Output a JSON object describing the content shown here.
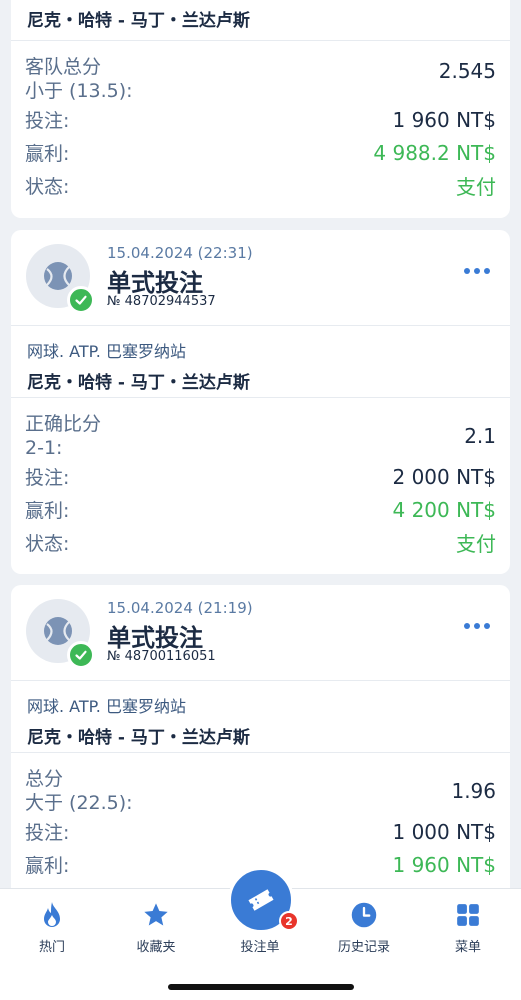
{
  "colors": {
    "accent": "#3a7bd5",
    "success": "#3db856",
    "badge": "#e8352b",
    "text_dark": "#1c2b43",
    "text_muted": "#5a6f8c",
    "background": "#eef1f5"
  },
  "cards": [
    {
      "event": "尼克・哈特 - 马丁・兰达卢斯",
      "market_title": "客队总分",
      "market_pick": "小于 (13.5):",
      "odds": "2.545",
      "stake_label": "投注:",
      "stake": "1 960 NT$",
      "win_label": "赢利:",
      "win": "4 988.2 NT$",
      "status_label": "状态:",
      "status": "支付"
    },
    {
      "date": "15.04.2024 (22:31)",
      "bet_type": "单式投注",
      "bet_number": "№ 48702944537",
      "league": "网球. ATP. 巴塞罗纳站",
      "event": "尼克・哈特 - 马丁・兰达卢斯",
      "market_title": "正确比分",
      "market_pick": "2-1:",
      "odds": "2.1",
      "stake_label": "投注:",
      "stake": "2 000 NT$",
      "win_label": "赢利:",
      "win": "4 200 NT$",
      "status_label": "状态:",
      "status": "支付",
      "sport_icon": "tennis-ball-icon",
      "status_icon": "check-icon"
    },
    {
      "date": "15.04.2024 (21:19)",
      "bet_type": "单式投注",
      "bet_number": "№ 48700116051",
      "league": "网球. ATP. 巴塞罗纳站",
      "event": "尼克・哈特 - 马丁・兰达卢斯",
      "market_title": "总分",
      "market_pick": "大于 (22.5):",
      "odds": "1.96",
      "stake_label": "投注:",
      "stake": "1 000 NT$",
      "win_label": "赢利:",
      "win": "1 960 NT$",
      "sport_icon": "tennis-ball-icon",
      "status_icon": "check-icon"
    }
  ],
  "bottom_nav": {
    "items": [
      {
        "label": "热门",
        "icon": "flame-icon"
      },
      {
        "label": "收藏夹",
        "icon": "star-icon"
      },
      {
        "label": "投注单",
        "icon": "ticket-icon",
        "badge": "2"
      },
      {
        "label": "历史记录",
        "icon": "clock-icon"
      },
      {
        "label": "菜单",
        "icon": "grid-icon"
      }
    ]
  }
}
